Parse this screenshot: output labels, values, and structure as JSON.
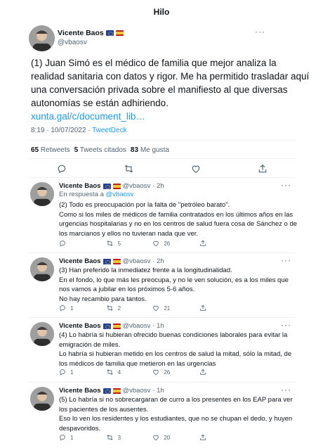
{
  "header": {
    "title": "Hilo"
  },
  "main_tweet": {
    "display_name": "Vicente Baos",
    "handle": "@vbaosv",
    "text": "(1) Juan Simó es el médico de familia que mejor analiza la realidad sanitaria con datos y rigor. Me ha permitido trasladar aquí una conversación privada sobre el manifiesto al que diversas autonomías se están adhiriendo.",
    "link": "xunta.gal/c/document_lib…",
    "time": "8:19 · 10/07/2022 ·",
    "source": "TweetDeck",
    "retweets_count": "65",
    "retweets_label": "Retweets",
    "quotes_count": "5",
    "quotes_label": "Tweets citados",
    "likes_count": "83",
    "likes_label": "Me gusta"
  },
  "replies": [
    {
      "display_name": "Vicente Baos",
      "handle": "@vbaosv",
      "time": "· 2h",
      "reply_to_prefix": "En respuesta a",
      "reply_to_handle": "@vbaosv",
      "text": "(2) Todo es preocupación por la falta de \"petróleo barato\".\nComo si los miles de médicos de familia contratados en los últimos años en las urgencias hospitalarias y no en los centros de salud fuera cosa de Sánchez o de los marcianos y ellos no tuvieran nada que ver.",
      "replies": "",
      "retweets": "5",
      "likes": "26"
    },
    {
      "display_name": "Vicente Baos",
      "handle": "@vbaosv",
      "time": "· 2h",
      "text": "(3) Han preferido la inmediatez frente a la longitudinalidad.\nEn el fondo, lo que más les preocupa, y no le ven solución, es a los miles que nos vamos a jubilar en los próximos 5-6 años.\nNo hay recambio para tantos.",
      "replies": "1",
      "retweets": "2",
      "likes": "21"
    },
    {
      "display_name": "Vicente Baos",
      "handle": "@vbaosv",
      "time": "· 1h",
      "text": "(4) Lo habría si hubieran ofrecido buenas condiciones laborales para evitar la emigración de miles.\nLo habría si hubieran metido en los centros de salud la mitad, sólo la mitad, de los médicos de familia que metieron en las urgencias",
      "replies": "1",
      "retweets": "4",
      "likes": "26"
    },
    {
      "display_name": "Vicente Baos",
      "handle": "@vbaosv",
      "time": "· 1h",
      "text": "(5) Lo habría si no sobrecargaran de curro a los presentes en los EAP para ver los pacientes de los ausentes.\nEso lo ven los residentes y los estudiantes, que no se chupan el dedo, y huyen despavoridos.",
      "replies": "1",
      "retweets": "3",
      "likes": "20"
    }
  ],
  "icons": {
    "reply": "reply-icon",
    "retweet": "retweet-icon",
    "like": "heart-icon",
    "share": "share-icon",
    "more": "more-icon"
  },
  "colors": {
    "link": "#1d9bf0",
    "muted": "#536471",
    "text": "#0f1419"
  }
}
